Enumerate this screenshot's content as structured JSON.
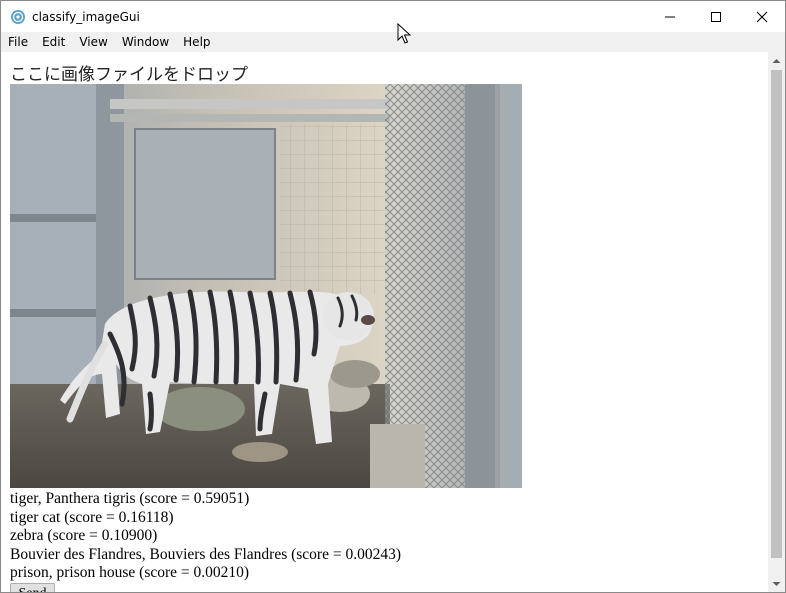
{
  "window": {
    "title": "classify_imageGui"
  },
  "menu": [
    "File",
    "Edit",
    "View",
    "Window",
    "Help"
  ],
  "drop_label": "ここに画像ファイルをドロップ",
  "image": {
    "icon": "tiger-photo"
  },
  "results": [
    "tiger, Panthera tigris (score = 0.59051)",
    "tiger cat (score = 0.16118)",
    "zebra (score = 0.10900)",
    "Bouvier des Flandres, Bouviers des Flandres (score = 0.00243)",
    "prison, prison house (score = 0.00210)"
  ],
  "send_label": "Send"
}
